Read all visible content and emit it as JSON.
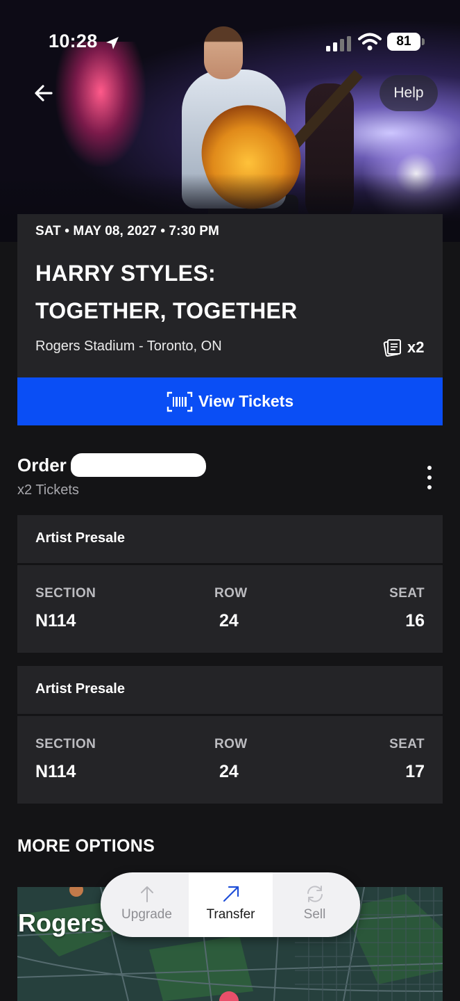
{
  "status_bar": {
    "time": "10:28",
    "battery": "81"
  },
  "header": {
    "help_label": "Help"
  },
  "event": {
    "date_line": "SAT • MAY 08, 2027 • 7:30 PM",
    "title_line1": "HARRY STYLES:",
    "title_line2": "TOGETHER, TOGETHER",
    "venue": "Rogers Stadium - Toronto, ON",
    "ticket_count": "x2"
  },
  "view_tickets_label": "View Tickets",
  "order": {
    "title": "Order",
    "subtitle": "x2 Tickets"
  },
  "tickets": [
    {
      "presale": "Artist Presale",
      "section_label": "SECTION",
      "row_label": "ROW",
      "seat_label": "SEAT",
      "section": "N114",
      "row": "24",
      "seat": "16"
    },
    {
      "presale": "Artist Presale",
      "section_label": "SECTION",
      "row_label": "ROW",
      "seat_label": "SEAT",
      "section": "N114",
      "row": "24",
      "seat": "17"
    }
  ],
  "more_options_label": "MORE OPTIONS",
  "map": {
    "label": "Rogers"
  },
  "actions": {
    "upgrade": "Upgrade",
    "transfer": "Transfer",
    "sell": "Sell"
  },
  "colors": {
    "accent_blue": "#0a4ef5",
    "card_bg": "#242427",
    "page_bg": "#141416"
  }
}
